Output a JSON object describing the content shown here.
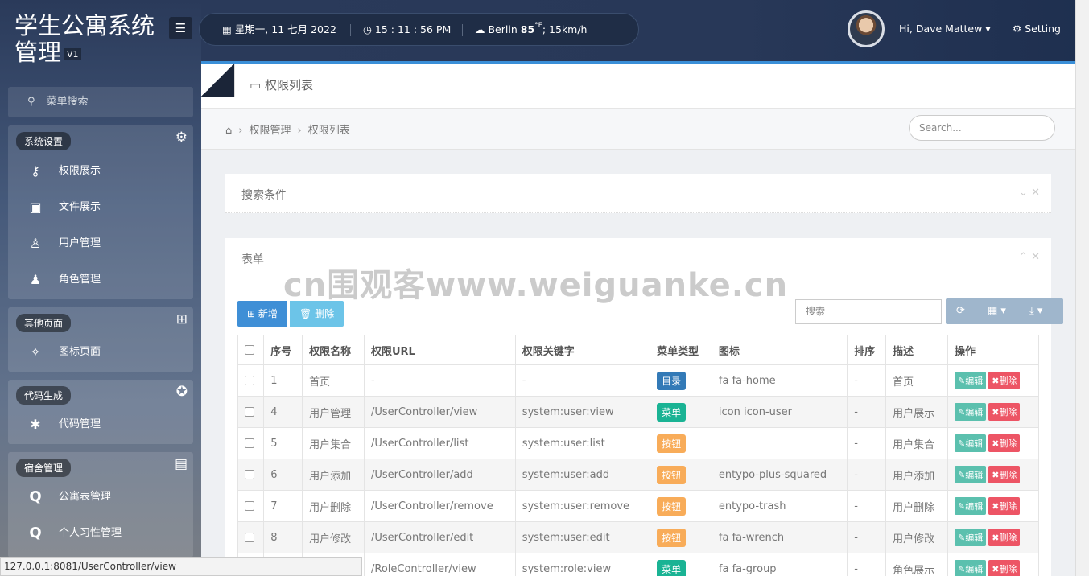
{
  "brand": {
    "title": "学生公寓系统管理",
    "version": "V1",
    "toggle_icon": "bars-icon"
  },
  "sidebar": {
    "search_placeholder": "菜单搜索",
    "groups": [
      {
        "title": "系统设置",
        "icon": "gear-icon",
        "items": [
          {
            "label": "权限展示",
            "icon": "key-icon"
          },
          {
            "label": "文件展示",
            "icon": "file-image-icon"
          },
          {
            "label": "用户管理",
            "icon": "user-icon"
          },
          {
            "label": "角色管理",
            "icon": "users-icon"
          }
        ]
      },
      {
        "title": "其他页面",
        "icon": "windows-icon",
        "items": [
          {
            "label": "图标页面",
            "icon": "magic-icon"
          }
        ]
      },
      {
        "title": "代码生成",
        "icon": "rebel-icon",
        "items": [
          {
            "label": "代码管理",
            "icon": "bug-icon"
          }
        ]
      },
      {
        "title": "宿舍管理",
        "icon": "contact-icon",
        "items": [
          {
            "label": "公寓表管理",
            "icon": "q-icon"
          },
          {
            "label": "个人习性管理",
            "icon": "q-icon"
          }
        ]
      }
    ]
  },
  "topbar": {
    "date": "星期一, 11 七月 2022",
    "time": "15 : 11 : 56 PM",
    "city": "Berlin",
    "temp": "85",
    "temp_unit": "°F",
    "wind": "; 15km/h",
    "user": "Hi, Dave Mattew",
    "setting": "Setting"
  },
  "page": {
    "title": "权限列表",
    "breadcrumb": [
      "权限管理",
      "权限列表"
    ],
    "search_placeholder": "Search..."
  },
  "search_panel": {
    "title": "搜索条件"
  },
  "form_panel": {
    "title": "表单",
    "add": "新增",
    "delete": "删除",
    "search_placeholder": "搜索"
  },
  "watermark": "cn围观客www.weiguanke.cn",
  "table": {
    "columns": [
      "序号",
      "权限名称",
      "权限URL",
      "权限关键字",
      "菜单类型",
      "图标",
      "排序",
      "描述",
      "操作"
    ],
    "edit_label": "编辑",
    "delete_label": "删除",
    "rows": [
      {
        "id": "1",
        "name": "首页",
        "url": "-",
        "key": "-",
        "type": "目录",
        "type_class": "t-dir",
        "icon": "fa fa-home",
        "sort": "-",
        "desc": "首页"
      },
      {
        "id": "4",
        "name": "用户管理",
        "url": "/UserController/view",
        "key": "system:user:view",
        "type": "菜单",
        "type_class": "t-menu",
        "icon": "icon icon-user",
        "sort": "-",
        "desc": "用户展示"
      },
      {
        "id": "5",
        "name": "用户集合",
        "url": "/UserController/list",
        "key": "system:user:list",
        "type": "按钮",
        "type_class": "t-btn",
        "icon": "",
        "sort": "-",
        "desc": "用户集合"
      },
      {
        "id": "6",
        "name": "用户添加",
        "url": "/UserController/add",
        "key": "system:user:add",
        "type": "按钮",
        "type_class": "t-btn",
        "icon": "entypo-plus-squared",
        "sort": "-",
        "desc": "用户添加"
      },
      {
        "id": "7",
        "name": "用户删除",
        "url": "/UserController/remove",
        "key": "system:user:remove",
        "type": "按钮",
        "type_class": "t-btn",
        "icon": "entypo-trash",
        "sort": "-",
        "desc": "用户删除"
      },
      {
        "id": "8",
        "name": "用户修改",
        "url": "/UserController/edit",
        "key": "system:user:edit",
        "type": "按钮",
        "type_class": "t-btn",
        "icon": "fa fa-wrench",
        "sort": "-",
        "desc": "用户修改"
      },
      {
        "id": "",
        "name": "",
        "url": "/RoleController/view",
        "key": "system:role:view",
        "type": "菜单",
        "type_class": "t-menu",
        "icon": "fa fa-group",
        "sort": "-",
        "desc": "角色展示"
      }
    ]
  },
  "status_url": "127.0.0.1:8081/UserController/view"
}
